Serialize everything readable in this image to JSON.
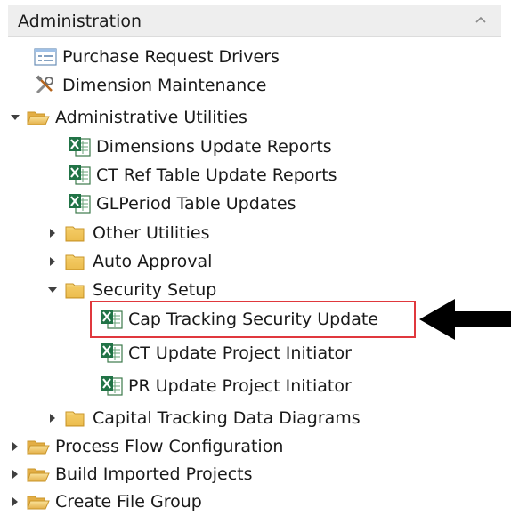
{
  "panel": {
    "title": "Administration",
    "collapse_icon": "chevron-up-icon"
  },
  "tree": {
    "purchase_request_drivers": {
      "label": "Purchase Request Drivers",
      "icon": "form-icon"
    },
    "dimension_maintenance": {
      "label": "Dimension Maintenance",
      "icon": "tools-icon"
    },
    "administrative_utilities": {
      "label": "Administrative Utilities",
      "icon": "folder-open-icon",
      "expanded": true
    },
    "dimensions_update_reports": {
      "label": "Dimensions Update Reports",
      "icon": "excel-icon"
    },
    "ct_ref_table_update_reports": {
      "label": "CT Ref Table Update Reports",
      "icon": "excel-icon"
    },
    "glperiod_table_updates": {
      "label": "GLPeriod Table Updates",
      "icon": "excel-icon"
    },
    "other_utilities": {
      "label": "Other Utilities",
      "icon": "folder-icon",
      "expanded": false
    },
    "auto_approval": {
      "label": "Auto Approval",
      "icon": "folder-icon",
      "expanded": false
    },
    "security_setup": {
      "label": "Security Setup",
      "icon": "folder-icon",
      "expanded": true
    },
    "cap_tracking_security_update": {
      "label": "Cap Tracking Security Update",
      "icon": "excel-icon",
      "highlighted": true
    },
    "ct_update_project_initiator": {
      "label": "CT Update Project Initiator",
      "icon": "excel-icon"
    },
    "pr_update_project_initiator": {
      "label": "PR Update Project Initiator",
      "icon": "excel-icon"
    },
    "capital_tracking_data_diagrams": {
      "label": "Capital Tracking Data Diagrams",
      "icon": "folder-icon",
      "expanded": false
    },
    "process_flow_configuration": {
      "label": "Process Flow Configuration",
      "icon": "folder-open-icon",
      "expanded": false
    },
    "build_imported_projects": {
      "label": "Build Imported Projects",
      "icon": "folder-open-icon",
      "expanded": false
    },
    "create_file_group": {
      "label": "Create File Group",
      "icon": "folder-open-icon",
      "expanded": false
    }
  },
  "annotation": {
    "highlight_color": "#e0383d",
    "arrow_color": "#000000",
    "arrow_icon": "arrow-left-icon"
  }
}
